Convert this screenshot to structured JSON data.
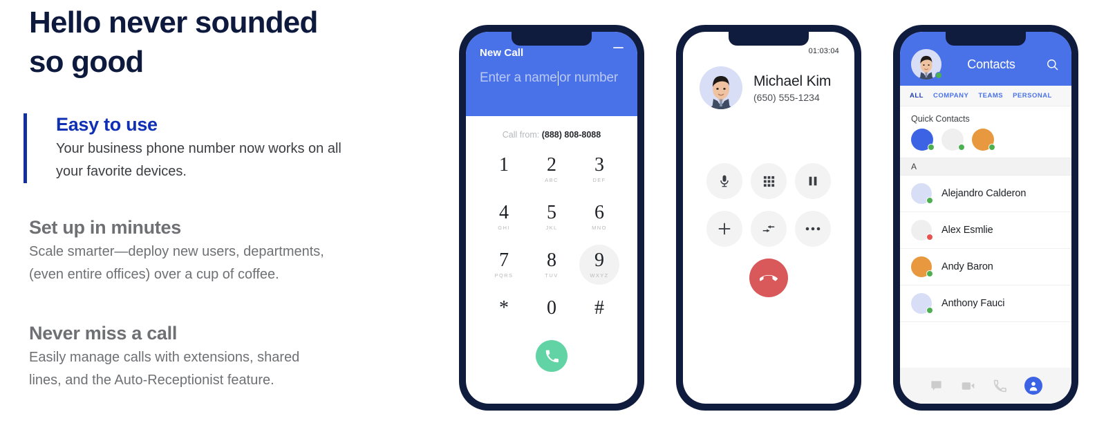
{
  "hero": {
    "title_line1": "Hello never sounded",
    "title_line2": "so good"
  },
  "features": [
    {
      "title": "Easy to use",
      "body_line1": "Your business phone number now works on all",
      "body_line2": "your favorite devices.",
      "accent": true,
      "accent_color": "#12309f",
      "title_color": "#0f2fb5"
    },
    {
      "title": "Set up in minutes",
      "body_line1": "Scale smarter—deploy new users, departments,",
      "body_line2": "(even entire offices) over a cup of coffee.",
      "accent": false,
      "title_color": "#6e7073"
    },
    {
      "title": "Never miss a call",
      "body_line1": "Easily manage calls with extensions, shared",
      "body_line2": "lines, and the Auto-Receptionist feature.",
      "accent": false,
      "title_color": "#6e7073"
    }
  ],
  "colors": {
    "brand_blue": "#4a72e8",
    "deep_navy": "#101c3d",
    "heading_navy": "#0d1a3d",
    "accent_blue": "#0f2fb5",
    "green_call": "#62d3a4",
    "red_hangup": "#d9585a",
    "status_online": "#4caf50",
    "status_busy": "#e8534f",
    "avatar_orange": "#e8993f",
    "avatar_blue": "#3c63e3",
    "avatar_gray": "#efefef",
    "avatar_lavender": "#d8def6"
  },
  "dialer": {
    "title": "New Call",
    "minimize_label": "Minimize",
    "input_value": "",
    "placeholder_before_caret": "Enter a name",
    "placeholder_after_caret": "or number",
    "call_from_label": "Call from:",
    "call_from_number": "(888) 808-8088",
    "keys": [
      [
        {
          "digit": "1",
          "letters": "",
          "pressed": false
        },
        {
          "digit": "2",
          "letters": "ABC",
          "pressed": false
        },
        {
          "digit": "3",
          "letters": "DEF",
          "pressed": false
        }
      ],
      [
        {
          "digit": "4",
          "letters": "GHI",
          "pressed": false
        },
        {
          "digit": "5",
          "letters": "JKL",
          "pressed": false
        },
        {
          "digit": "6",
          "letters": "MNO",
          "pressed": false
        }
      ],
      [
        {
          "digit": "7",
          "letters": "PQRS",
          "pressed": false
        },
        {
          "digit": "8",
          "letters": "TUV",
          "pressed": false
        },
        {
          "digit": "9",
          "letters": "WXYZ",
          "pressed": true
        }
      ],
      [
        {
          "digit": "*",
          "letters": "",
          "pressed": false
        },
        {
          "digit": "0",
          "letters": "",
          "pressed": false
        },
        {
          "digit": "#",
          "letters": "",
          "pressed": false
        }
      ]
    ],
    "call_button_icon": "phone-icon"
  },
  "active_call": {
    "timer": "01:03:04",
    "contact_name": "Michael Kim",
    "contact_number": "(650) 555-1234",
    "avatar_icon": "contact-photo",
    "controls": [
      [
        {
          "name": "mute-button",
          "icon": "microphone-icon"
        },
        {
          "name": "keypad-button",
          "icon": "keypad-grid-icon"
        },
        {
          "name": "hold-button",
          "icon": "pause-icon"
        }
      ],
      [
        {
          "name": "add-call-button",
          "icon": "plus-icon"
        },
        {
          "name": "transfer-button",
          "icon": "transfer-arrows-icon"
        },
        {
          "name": "more-button",
          "icon": "ellipsis-icon"
        }
      ]
    ],
    "hangup": {
      "name": "hangup-button",
      "icon": "phone-down-icon"
    }
  },
  "contacts": {
    "header_title": "Contacts",
    "search_icon": "search-icon",
    "avatar_status": "online",
    "tabs": [
      {
        "label": "ALL",
        "active": true
      },
      {
        "label": "COMPANY",
        "active": false
      },
      {
        "label": "TEAMS",
        "active": false
      },
      {
        "label": "PERSONAL",
        "active": false
      }
    ],
    "quick_contacts_label": "Quick Contacts",
    "quick_contacts": [
      {
        "color": "#3c63e3",
        "status": "online"
      },
      {
        "color": "#efefef",
        "status": "online"
      },
      {
        "color": "#e8993f",
        "status": "online"
      }
    ],
    "alpha_header": "A",
    "list": [
      {
        "name": "Alejandro Calderon",
        "color": "#d8def6",
        "status": "online"
      },
      {
        "name": "Alex Esmlie",
        "color": "#efefef",
        "status": "busy"
      },
      {
        "name": "Andy Baron",
        "color": "#e8993f",
        "status": "online"
      },
      {
        "name": "Anthony Fauci",
        "color": "#d8def6",
        "status": "online"
      }
    ],
    "nav": [
      {
        "name": "nav-messages",
        "icon": "chat-bubble-icon",
        "active": false
      },
      {
        "name": "nav-video",
        "icon": "video-camera-icon",
        "active": false
      },
      {
        "name": "nav-phone",
        "icon": "phone-handset-icon",
        "active": false
      },
      {
        "name": "nav-contacts",
        "icon": "person-icon",
        "active": true
      }
    ]
  }
}
